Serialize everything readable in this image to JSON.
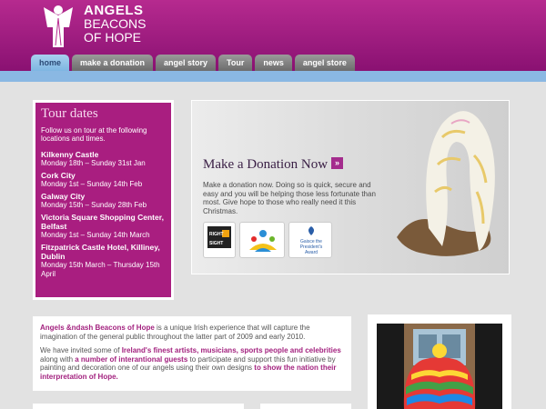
{
  "logo": {
    "line1": "ANGELS",
    "line2": "BEACONS",
    "line3": "OF HOPE"
  },
  "nav": [
    {
      "label": "home",
      "active": true
    },
    {
      "label": "make a donation",
      "active": false
    },
    {
      "label": "angel story",
      "active": false
    },
    {
      "label": "Tour",
      "active": false
    },
    {
      "label": "news",
      "active": false
    },
    {
      "label": "angel store",
      "active": false
    }
  ],
  "tour": {
    "title": "Tour dates",
    "intro": "Follow us on tour at the following locations and times.",
    "stops": [
      {
        "venue": "Kilkenny Castle",
        "date": "Monday 18th – Sunday 31st Jan"
      },
      {
        "venue": "Cork City",
        "date": "Monday 1st – Sunday 14th Feb"
      },
      {
        "venue": "Galway City",
        "date": "Monday 15th – Sunday 28th Feb"
      },
      {
        "venue": "Victoria Square Shopping Center, Belfast",
        "date": "Monday 1st – Sunday 14th March"
      },
      {
        "venue": "Fitzpatrick Castle Hotel, Killiney, Dublin",
        "date": "Monday 15th March – Thursday 15th April"
      }
    ]
  },
  "donation": {
    "title": "Make a Donation Now",
    "arrow": "»",
    "text": "Make a donation now. Doing so is quick, secure and easy and you will be helping those less fortunate than most. Give hope to those who really need it this Christmas.",
    "badges": [
      "RIGHT to SIGHT",
      "",
      "Gaisce the President's Award"
    ]
  },
  "intro": {
    "p1_lead": "Angels &ndash Beacons of Hope",
    "p1_rest": " is a unique Irish experience that will capture the imagination of the general public throughout the latter part of 2009 and early 2010.",
    "p2_a": "We have invited some of ",
    "p2_b": "Ireland's finest artists, musicians, sports people and celebrities",
    "p2_c": " along with ",
    "p2_d": "a number of interantional guests",
    "p2_e": " to participate and support this fun initiative by painting and decoration one of our angels using their own designs ",
    "p2_f": "to show the nation their interpretation of Hope."
  },
  "colors": {
    "brand": "#a91e80",
    "nav_active": "#8ab8e3",
    "background": "#e2e2e2"
  }
}
